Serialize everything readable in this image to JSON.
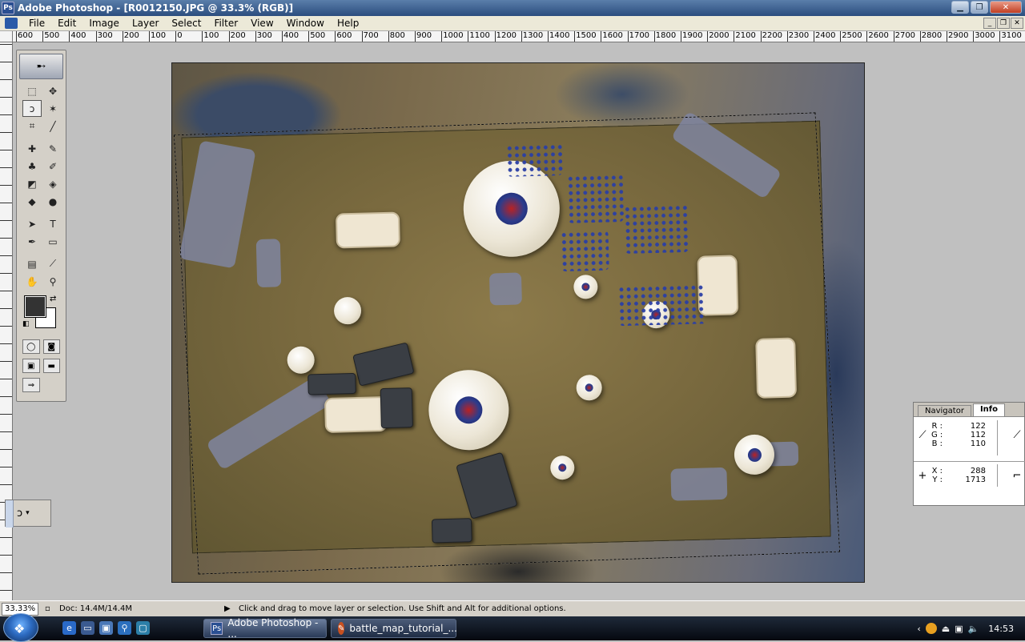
{
  "window": {
    "title": "Adobe Photoshop - [R0012150.JPG @ 33.3% (RGB)]",
    "app_icon": "Ps"
  },
  "menu": [
    "File",
    "Edit",
    "Image",
    "Layer",
    "Select",
    "Filter",
    "View",
    "Window",
    "Help"
  ],
  "ruler": {
    "ticks": [
      "600",
      "500",
      "400",
      "300",
      "200",
      "100",
      "0",
      "100",
      "200",
      "300",
      "400",
      "500",
      "600",
      "700",
      "800",
      "900",
      "1000",
      "1100",
      "1200",
      "1300",
      "1400",
      "1500",
      "1600",
      "1700",
      "1800",
      "1900",
      "2000",
      "2100",
      "2200",
      "2300",
      "2400",
      "2500",
      "2600",
      "2700",
      "2800",
      "2900",
      "3000",
      "3100"
    ]
  },
  "toolbox": {
    "tools": [
      {
        "name": "marquee-tool",
        "glyph": "⬚"
      },
      {
        "name": "move-tool",
        "glyph": "✥"
      },
      {
        "name": "lasso-tool",
        "glyph": "ↄ"
      },
      {
        "name": "magic-wand-tool",
        "glyph": "✶"
      },
      {
        "name": "crop-tool",
        "glyph": "⌗"
      },
      {
        "name": "slice-tool",
        "glyph": "╱"
      },
      {
        "name": "healing-brush-tool",
        "glyph": "✚"
      },
      {
        "name": "brush-tool",
        "glyph": "✎"
      },
      {
        "name": "clone-stamp-tool",
        "glyph": "♣"
      },
      {
        "name": "history-brush-tool",
        "glyph": "✐"
      },
      {
        "name": "eraser-tool",
        "glyph": "◩"
      },
      {
        "name": "paint-bucket-tool",
        "glyph": "◈"
      },
      {
        "name": "blur-tool",
        "glyph": "◆"
      },
      {
        "name": "dodge-tool",
        "glyph": "●"
      },
      {
        "name": "path-selection-tool",
        "glyph": "➤"
      },
      {
        "name": "type-tool",
        "glyph": "T"
      },
      {
        "name": "pen-tool",
        "glyph": "✒"
      },
      {
        "name": "shape-tool",
        "glyph": "▭"
      },
      {
        "name": "notes-tool",
        "glyph": "▤"
      },
      {
        "name": "eyedropper-tool",
        "glyph": "⟋"
      },
      {
        "name": "hand-tool",
        "glyph": "✋"
      },
      {
        "name": "zoom-tool",
        "glyph": "⚲"
      }
    ],
    "foreground_color": "#333333",
    "background_color": "#ffffff"
  },
  "info_palette": {
    "tabs": [
      "Navigator",
      "Info"
    ],
    "active_tab": "Info",
    "rgb": {
      "labels": "R :\nG :\nB :",
      "r": "122",
      "g": "112",
      "b": "110"
    },
    "xy": {
      "labels": "X :\nY :",
      "x": "288",
      "y": "1713"
    }
  },
  "status": {
    "zoom": "33.33%",
    "doc": "Doc: 14.4M/14.4M",
    "hint": "Click and drag to move layer or selection.  Use Shift and Alt for additional options."
  },
  "taskbar": {
    "buttons": [
      {
        "label": "Adobe Photoshop - ..."
      },
      {
        "label": "battle_map_tutorial_..."
      }
    ],
    "clock": "14:53"
  },
  "colors": {
    "titlebar": "#2b4d7e",
    "selection_marquee": "#ffffff",
    "table_surface": "#7a6a3f"
  }
}
